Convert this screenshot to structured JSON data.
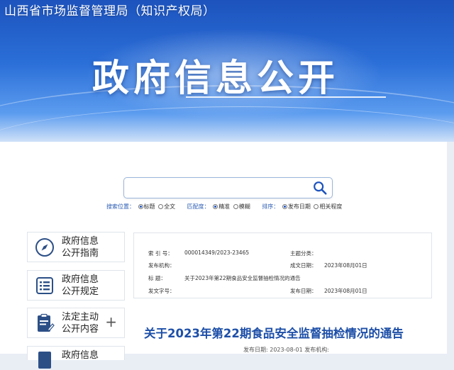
{
  "header": {
    "site_title": "山西省市场监督管理局（知识产权局）",
    "page_heading": "政府信息公开"
  },
  "search": {
    "placeholder": "",
    "scope_label": "搜索位置：",
    "scope_options": [
      "标题",
      "全文"
    ],
    "scope_selected": "标题",
    "match_label": "匹配度：",
    "match_options": [
      "精准",
      "模糊"
    ],
    "match_selected": "精准",
    "sort_label": "排序：",
    "sort_options": [
      "发布日期",
      "相关程度"
    ],
    "sort_selected": "发布日期"
  },
  "sidebar": {
    "items": [
      {
        "line1": "政府信息",
        "line2": "公开指南",
        "icon": "compass-icon"
      },
      {
        "line1": "政府信息",
        "line2": "公开规定",
        "icon": "list-document-icon"
      },
      {
        "line1": "法定主动",
        "line2": "公开内容",
        "icon": "edit-document-icon",
        "expand": "+"
      },
      {
        "line1": "政府信息",
        "line2": "",
        "icon": "document-icon"
      }
    ]
  },
  "info": {
    "index_label": "索  引  号：",
    "index_value": "000014349/2023-23465",
    "category_label": "主题分类：",
    "category_value": "",
    "publisher_label": "发布机构：",
    "publisher_value": "",
    "created_label": "成文日期：",
    "created_value": "2023年08月01日",
    "title_label": "标        题：",
    "title_value": "关于2023年第22期食品安全监督抽检情况的通告",
    "docno_label": "发文字号：",
    "docno_value": "",
    "published_label": "发布日期：",
    "published_value": "2023年08月01日"
  },
  "document": {
    "title": "关于2023年第22期食品安全监督抽检情况的通告",
    "meta": "发布日期: 2023-08-01 发布机构:"
  },
  "colors": {
    "brand_blue": "#1d53bd",
    "title_blue": "#1d4fa8"
  }
}
